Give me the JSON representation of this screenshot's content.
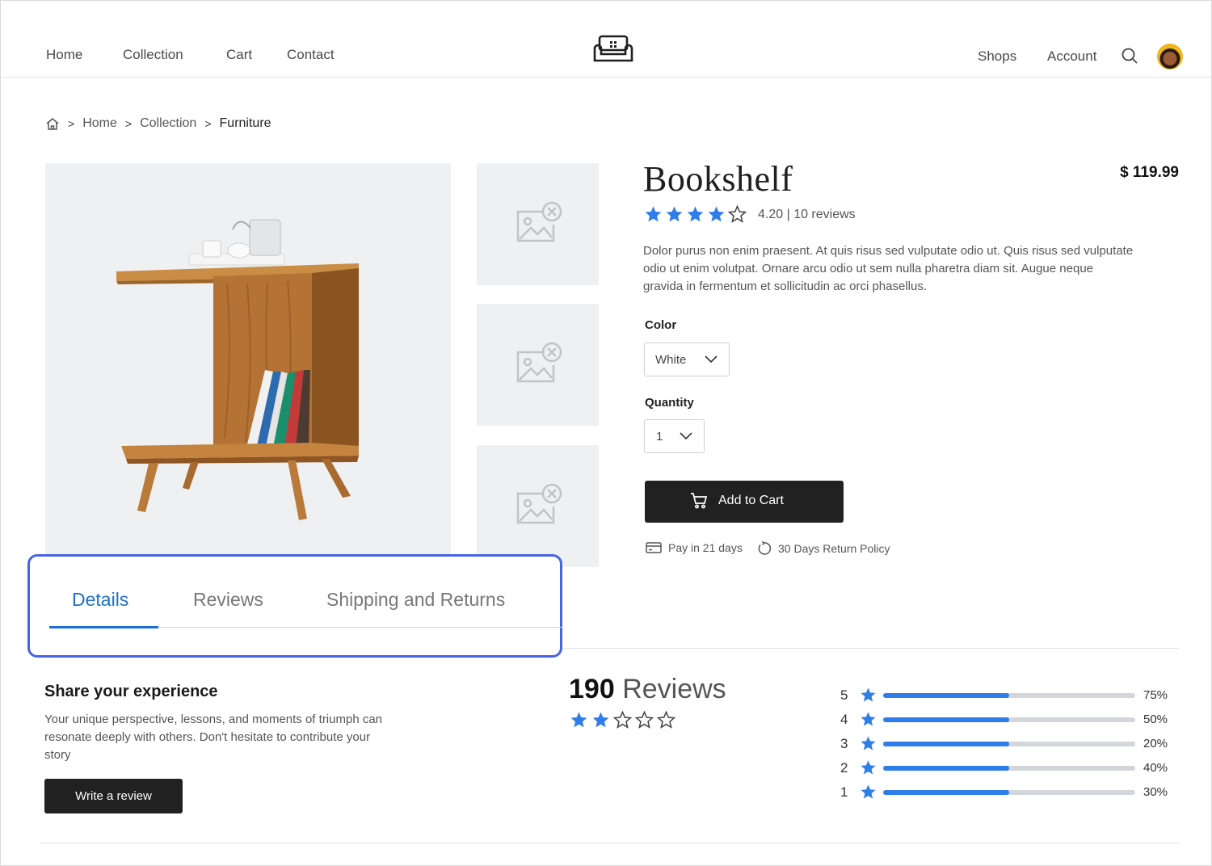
{
  "nav": {
    "left": [
      "Home",
      "Collection",
      "Cart",
      "Contact"
    ],
    "right": [
      "Shops",
      "Account"
    ]
  },
  "breadcrumb": [
    "Home",
    "Collection",
    "Furniture"
  ],
  "product": {
    "title": "Bookshelf",
    "price": "$ 119.99",
    "rating": 4,
    "rating_text": "4.20 | 10 reviews",
    "description": "Dolor purus non enim praesent. At quis risus sed vulputate odio ut. Quis risus sed vulputate odio ut enim volutpat. Ornare arcu odio ut sem nulla pharetra diam sit. Augue neque gravida in fermentum et sollicitudin ac orci phasellus.",
    "color_label": "Color",
    "color_value": "White",
    "quantity_label": "Quantity",
    "quantity_value": "1",
    "add_to_cart": "Add to Cart",
    "perk_pay": "Pay in 21 days",
    "perk_return": "30 Days Return Policy"
  },
  "tabs": [
    "Details",
    "Reviews",
    "Shipping and Returns"
  ],
  "share": {
    "title": "Share your experience",
    "text": "Your unique perspective, lessons, and moments of triumph can resonate deeply with others. Don't hesitate to contribute your story",
    "button": "Write a review"
  },
  "reviews": {
    "count": "190",
    "count_label": "Reviews",
    "stars": 2,
    "distribution": [
      {
        "star": "5",
        "percent": "75%",
        "fill": 0.5
      },
      {
        "star": "4",
        "percent": "50%",
        "fill": 0.5
      },
      {
        "star": "3",
        "percent": "20%",
        "fill": 0.5
      },
      {
        "star": "2",
        "percent": "40%",
        "fill": 0.5
      },
      {
        "star": "1",
        "percent": "30%",
        "fill": 0.5
      }
    ]
  },
  "colors": {
    "accent": "#1d6fd1",
    "star": "#2f7de8",
    "highlight": "#4763e8",
    "button": "#212121"
  }
}
